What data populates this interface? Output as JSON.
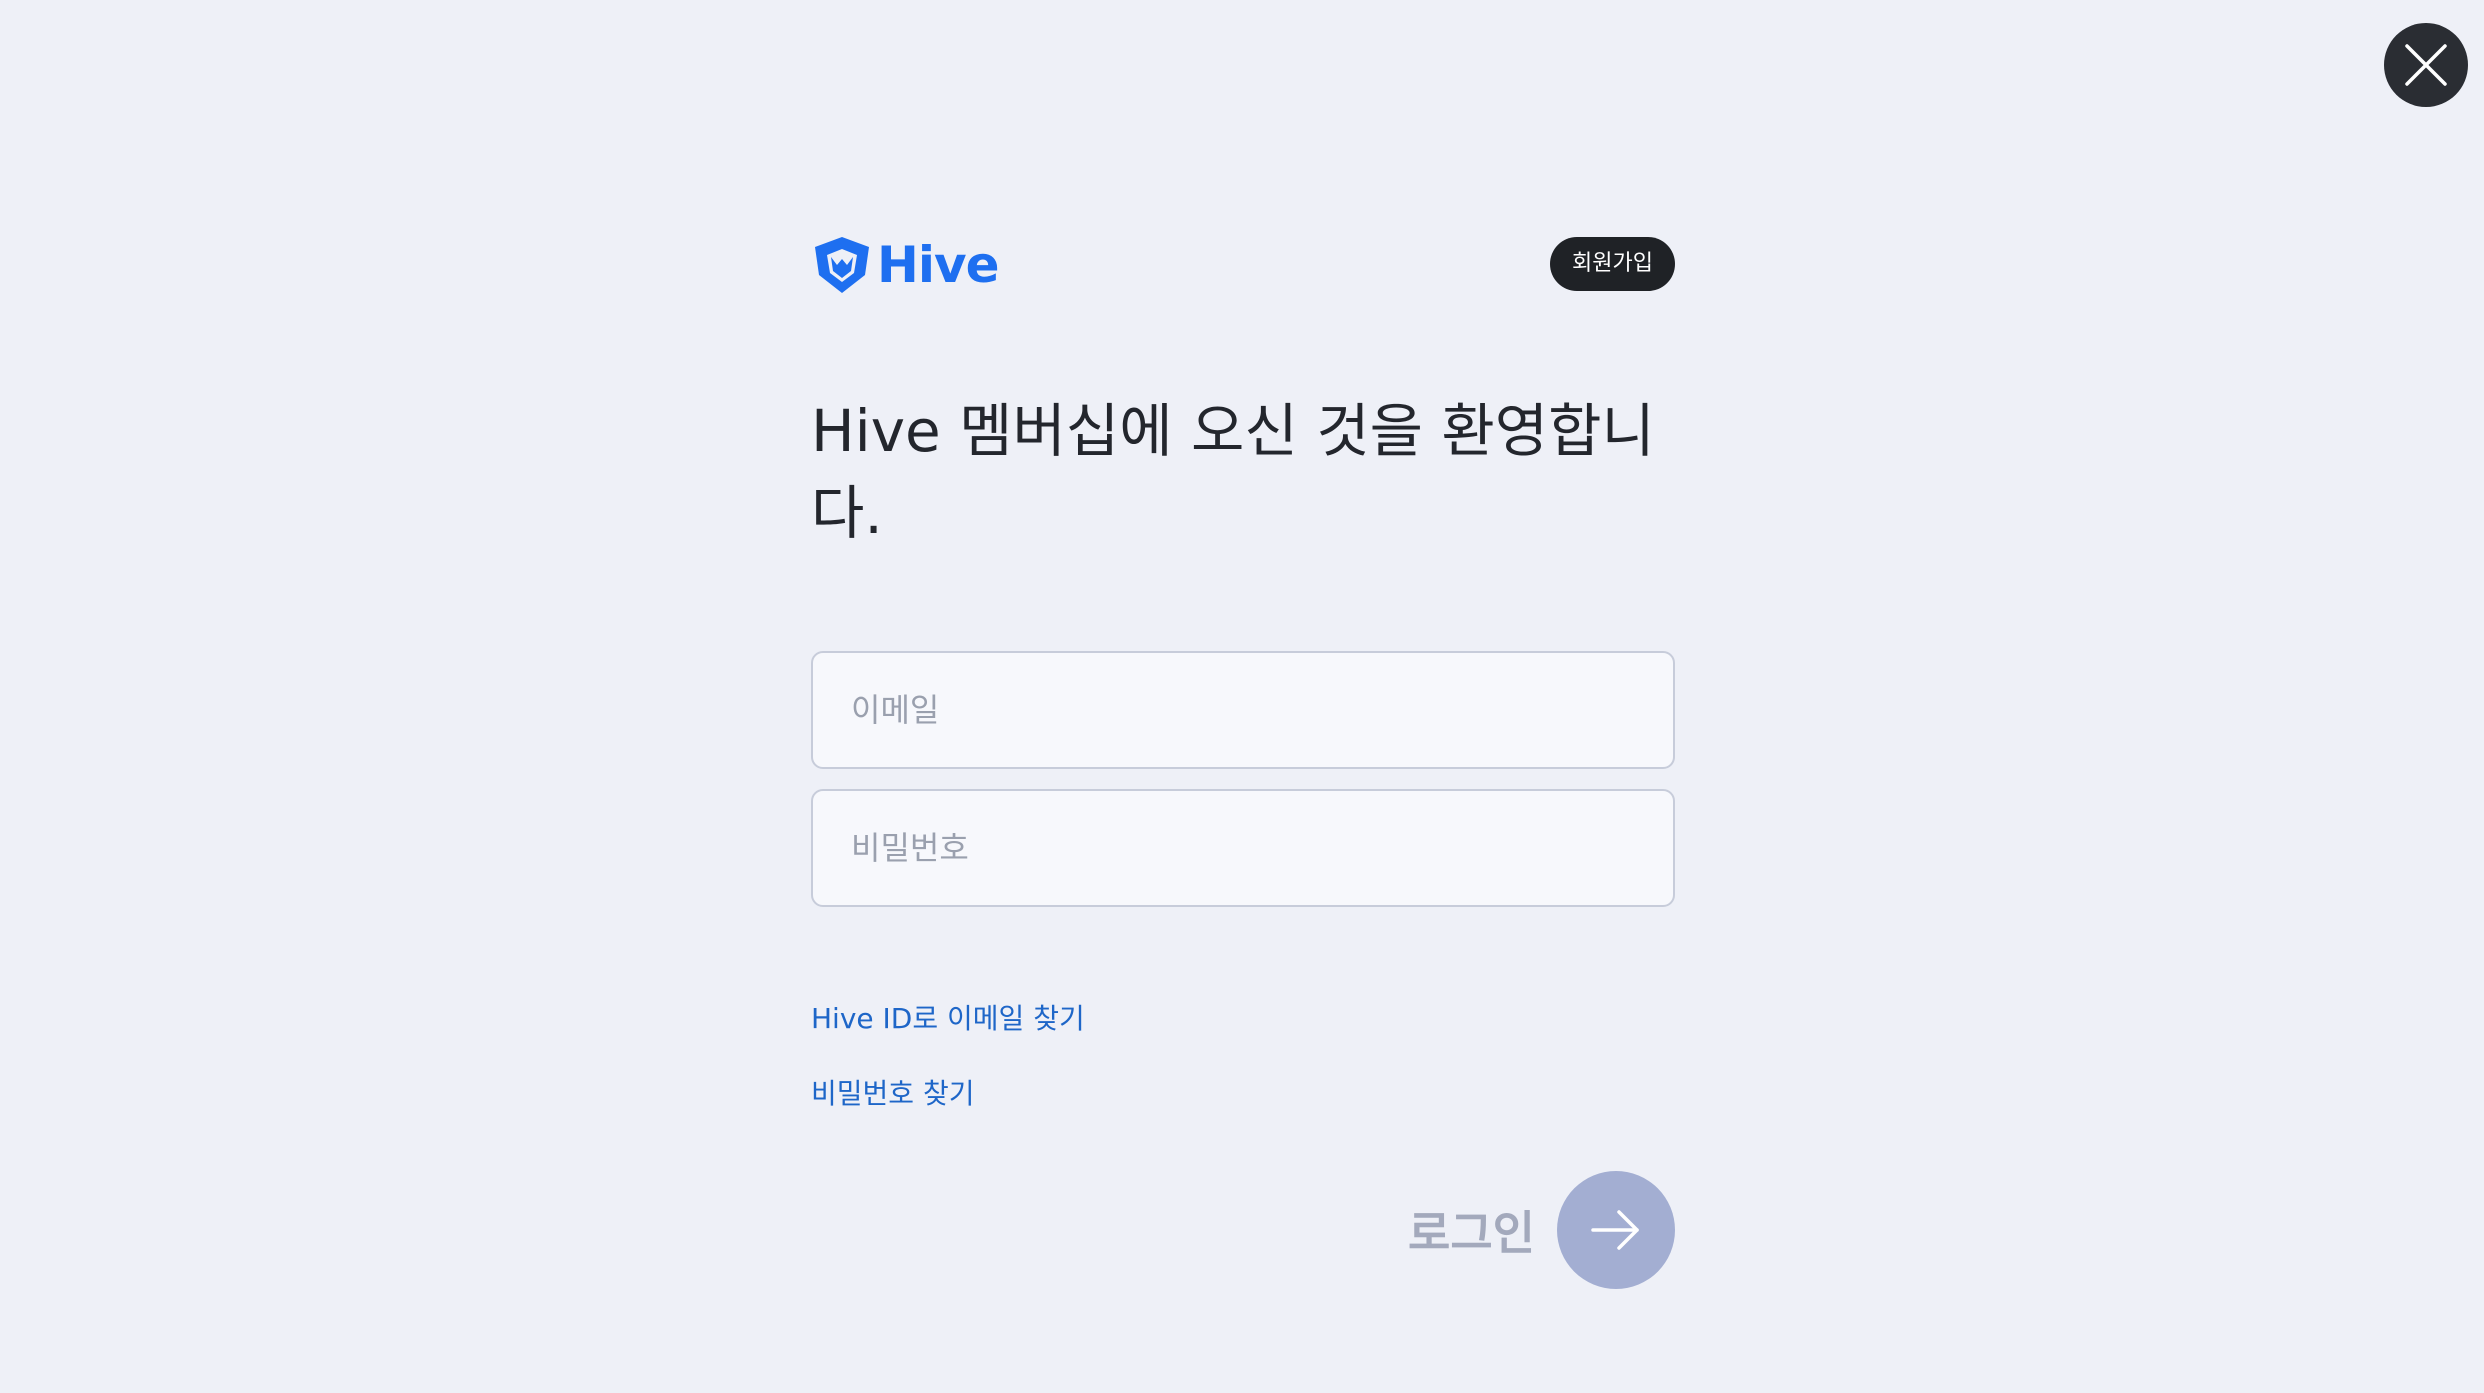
{
  "close": {
    "icon": "close-icon"
  },
  "header": {
    "logo_text": "Hive",
    "logo_icon": "hive-shield-icon",
    "signup_label": "회원가입"
  },
  "headline": "Hive 멤버십에 오신 것을 환영합니다.",
  "form": {
    "email_placeholder": "이메일",
    "email_value": "",
    "password_placeholder": "비밀번호",
    "password_value": ""
  },
  "links": {
    "find_email": "Hive ID로 이메일 찾기",
    "find_password": "비밀번호 찾기"
  },
  "login": {
    "label": "로그인",
    "icon": "arrow-right-icon"
  },
  "colors": {
    "background": "#eef0f7",
    "brand": "#1e6ff0",
    "link": "#1e66c8",
    "dark_button": "#1f2226",
    "login_disabled": "#a3aed2",
    "login_label_disabled": "#a3a9bc"
  }
}
